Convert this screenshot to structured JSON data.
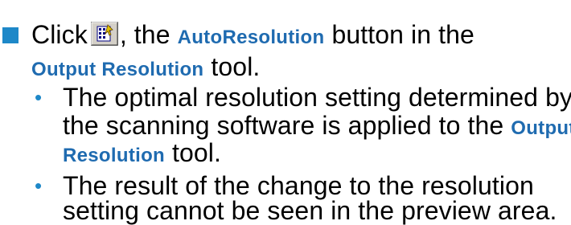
{
  "step": {
    "prefix": "Click",
    "button_icon": "autoresolution-button-icon",
    "after_icon": ", the",
    "button_name": "AutoResolution",
    "after_button": "button in the",
    "tool_name": "Output Resolution",
    "tool_suffix": "tool."
  },
  "results": [
    {
      "line1": "The optimal resolution setting determined by",
      "line2_text": "the scanning software is applied to the",
      "line2_kw": "Output",
      "line3_kw": "Resolution",
      "line3_text": "tool."
    },
    {
      "line1": "The result of the change to the resolution",
      "line2": "setting cannot be seen in the preview area."
    }
  ],
  "colors": {
    "bullet": "#1e88c8",
    "keyword": "#1f6bb0",
    "text": "#000000"
  }
}
